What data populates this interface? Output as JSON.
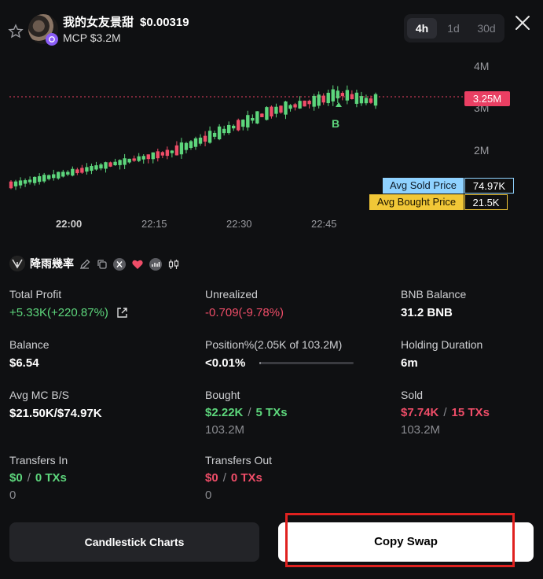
{
  "header": {
    "token_name": "我的女友景甜",
    "token_price": "$0.00319",
    "mcp": "MCP $3.2M",
    "timeframes": [
      {
        "label": "4h",
        "active": true
      },
      {
        "label": "1d",
        "active": false
      },
      {
        "label": "30d",
        "active": false
      }
    ]
  },
  "chart_data": {
    "type": "candlestick",
    "y_axis_labels": [
      "4M",
      "3M",
      "2M"
    ],
    "x_axis_labels": [
      "22:00",
      "22:15",
      "22:30",
      "22:45"
    ],
    "current_price_label": "3.25M",
    "markers": [
      "B"
    ],
    "avg_sold": {
      "label": "Avg Sold Price",
      "value": "74.97K"
    },
    "avg_bought": {
      "label": "Avg Bought Price",
      "value": "21.5K"
    },
    "colors": {
      "up": "#5dd67c",
      "down": "#ef4d68",
      "price_line": "#ea3f63"
    }
  },
  "trader": {
    "name": "降雨幾率"
  },
  "stats": {
    "total_profit": {
      "label": "Total Profit",
      "value": "+5.33K(+220.87%)"
    },
    "unrealized": {
      "label": "Unrealized",
      "value": "-0.709(-9.78%)"
    },
    "bnb_balance": {
      "label": "BNB Balance",
      "value": "31.2 BNB"
    },
    "balance": {
      "label": "Balance",
      "value": "$6.54"
    },
    "position": {
      "label": "Position%(2.05K of 103.2M)",
      "value": "<0.01%",
      "fill_fraction": 0.0
    },
    "holding_duration": {
      "label": "Holding Duration",
      "value": "6m"
    },
    "avg_mc": {
      "label": "Avg MC B/S",
      "value": "$21.50K/$74.97K"
    },
    "bought": {
      "label": "Bought",
      "usd": "$2.22K",
      "sep": "/",
      "txs": "5 TXs",
      "amount": "103.2M"
    },
    "sold": {
      "label": "Sold",
      "usd": "$7.74K",
      "sep": "/",
      "txs": "15 TXs",
      "amount": "103.2M"
    },
    "transfers_in": {
      "label": "Transfers In",
      "usd": "$0",
      "sep": "/",
      "txs": "0 TXs",
      "amount": "0"
    },
    "transfers_out": {
      "label": "Transfers Out",
      "usd": "$0",
      "sep": "/",
      "txs": "0 TXs",
      "amount": "0"
    }
  },
  "actions": {
    "candlestick_label": "Candlestick Charts",
    "copy_swap_label": "Copy Swap"
  }
}
